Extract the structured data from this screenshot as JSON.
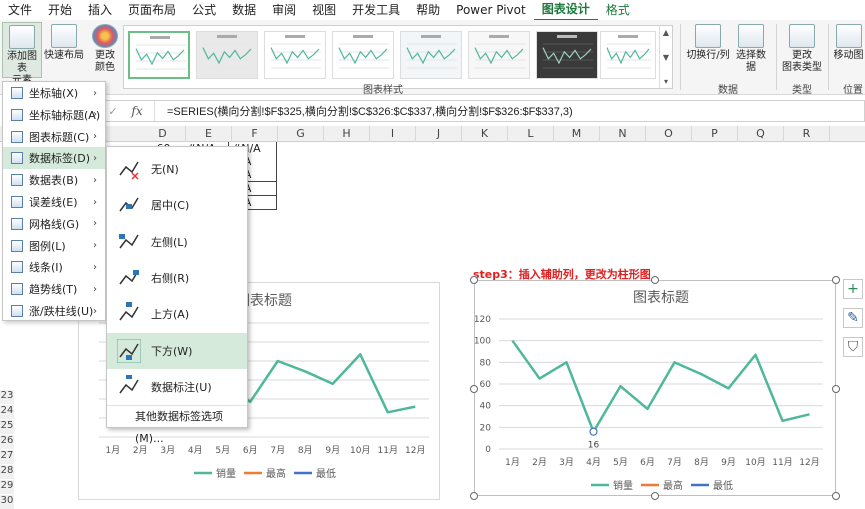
{
  "tabs": [
    "文件",
    "开始",
    "插入",
    "页面布局",
    "公式",
    "数据",
    "审阅",
    "视图",
    "开发工具",
    "帮助",
    "Power Pivot",
    "图表设计",
    "格式"
  ],
  "active_tab": "图表设计",
  "ribbon": {
    "add_element": "添加图表\n元素",
    "quick_layout": "快速布局",
    "change_colors": "更改\n颜色",
    "styles_group": "图表样式",
    "switch_row_col": "切换行/列",
    "select_data": "选择数据",
    "data_group": "数据",
    "change_type": "更改\n图表类型",
    "type_group": "类型",
    "move_chart": "移动图",
    "location_group": "位置"
  },
  "formula": "=SERIES(横向分割!$F$325,横向分割!$C$326:$C$337,横向分割!$F$326:$F$337,3)",
  "columns": [
    "D",
    "E",
    "F",
    "G",
    "H",
    "I",
    "J",
    "K",
    "L",
    "M",
    "N",
    "O",
    "P",
    "Q",
    "R"
  ],
  "cells": {
    "d1": "60",
    "e1": "#N/A",
    "f1": "#N/A",
    "f2": "N/A",
    "f3": "N/A",
    "f4": "N/A",
    "f5": "N/A",
    "f6": "N/A"
  },
  "row_numbers": [
    "23",
    "24",
    "25",
    "26",
    "27",
    "28",
    "29",
    "30"
  ],
  "step3": "step3：插入辅助列，更改为柱形图",
  "menu": {
    "items": [
      {
        "label": "坐标轴(X)"
      },
      {
        "label": "坐标轴标题(A)"
      },
      {
        "label": "图表标题(C)"
      },
      {
        "label": "数据标签(D)"
      },
      {
        "label": "数据表(B)"
      },
      {
        "label": "误差线(E)"
      },
      {
        "label": "网格线(G)"
      },
      {
        "label": "图例(L)"
      },
      {
        "label": "线条(I)"
      },
      {
        "label": "趋势线(T)"
      },
      {
        "label": "涨/跌柱线(U)"
      }
    ]
  },
  "submenu": {
    "items": [
      "无(N)",
      "居中(C)",
      "左侧(L)",
      "右侧(R)",
      "上方(A)",
      "下方(W)",
      "数据标注(U)"
    ],
    "more": "其他数据标签选项(M)..."
  },
  "chart_data": [
    {
      "type": "line",
      "title": "图表标题",
      "categories": [
        "1月",
        "2月",
        "3月",
        "4月",
        "5月",
        "6月",
        "7月",
        "8月",
        "9月",
        "10月",
        "11月",
        "12月"
      ],
      "series": [
        {
          "name": "销量",
          "color": "#4fb89a",
          "values": [
            100,
            65,
            80,
            16,
            58,
            37,
            80,
            69,
            56,
            87,
            26,
            32
          ]
        },
        {
          "name": "最高",
          "color": "#ed7d31"
        },
        {
          "name": "最低",
          "color": "#4472c4"
        }
      ],
      "ylim": [
        0,
        120
      ],
      "yticks": [
        "0",
        "20",
        "40",
        "60",
        "80",
        "100",
        "120"
      ],
      "data_label": "16",
      "legend": "bottom"
    }
  ]
}
